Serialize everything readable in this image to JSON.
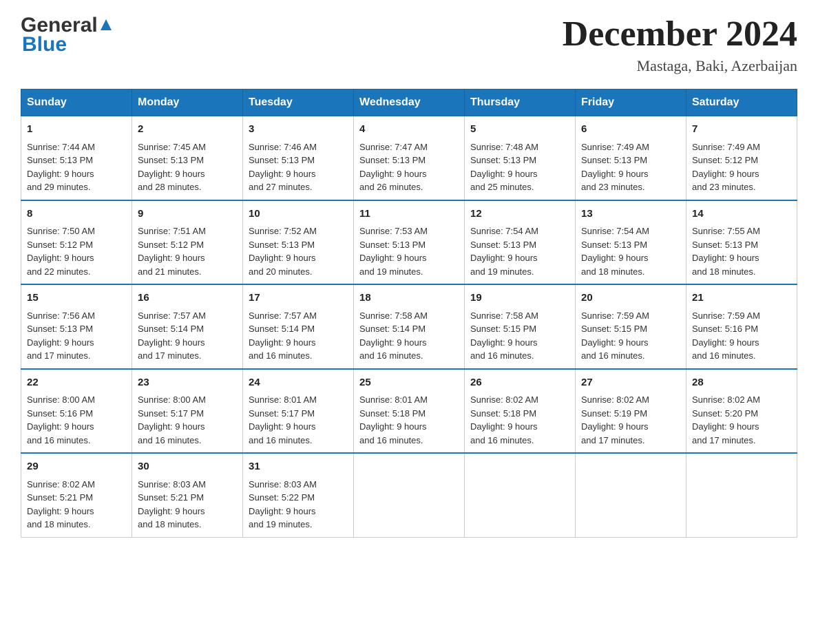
{
  "header": {
    "logo_general": "General",
    "logo_blue": "Blue",
    "month_year": "December 2024",
    "location": "Mastaga, Baki, Azerbaijan"
  },
  "days_header": [
    "Sunday",
    "Monday",
    "Tuesday",
    "Wednesday",
    "Thursday",
    "Friday",
    "Saturday"
  ],
  "weeks": [
    [
      {
        "day": "1",
        "sunrise": "7:44 AM",
        "sunset": "5:13 PM",
        "daylight": "9 hours and 29 minutes."
      },
      {
        "day": "2",
        "sunrise": "7:45 AM",
        "sunset": "5:13 PM",
        "daylight": "9 hours and 28 minutes."
      },
      {
        "day": "3",
        "sunrise": "7:46 AM",
        "sunset": "5:13 PM",
        "daylight": "9 hours and 27 minutes."
      },
      {
        "day": "4",
        "sunrise": "7:47 AM",
        "sunset": "5:13 PM",
        "daylight": "9 hours and 26 minutes."
      },
      {
        "day": "5",
        "sunrise": "7:48 AM",
        "sunset": "5:13 PM",
        "daylight": "9 hours and 25 minutes."
      },
      {
        "day": "6",
        "sunrise": "7:49 AM",
        "sunset": "5:13 PM",
        "daylight": "9 hours and 23 minutes."
      },
      {
        "day": "7",
        "sunrise": "7:49 AM",
        "sunset": "5:12 PM",
        "daylight": "9 hours and 23 minutes."
      }
    ],
    [
      {
        "day": "8",
        "sunrise": "7:50 AM",
        "sunset": "5:12 PM",
        "daylight": "9 hours and 22 minutes."
      },
      {
        "day": "9",
        "sunrise": "7:51 AM",
        "sunset": "5:12 PM",
        "daylight": "9 hours and 21 minutes."
      },
      {
        "day": "10",
        "sunrise": "7:52 AM",
        "sunset": "5:13 PM",
        "daylight": "9 hours and 20 minutes."
      },
      {
        "day": "11",
        "sunrise": "7:53 AM",
        "sunset": "5:13 PM",
        "daylight": "9 hours and 19 minutes."
      },
      {
        "day": "12",
        "sunrise": "7:54 AM",
        "sunset": "5:13 PM",
        "daylight": "9 hours and 19 minutes."
      },
      {
        "day": "13",
        "sunrise": "7:54 AM",
        "sunset": "5:13 PM",
        "daylight": "9 hours and 18 minutes."
      },
      {
        "day": "14",
        "sunrise": "7:55 AM",
        "sunset": "5:13 PM",
        "daylight": "9 hours and 18 minutes."
      }
    ],
    [
      {
        "day": "15",
        "sunrise": "7:56 AM",
        "sunset": "5:13 PM",
        "daylight": "9 hours and 17 minutes."
      },
      {
        "day": "16",
        "sunrise": "7:57 AM",
        "sunset": "5:14 PM",
        "daylight": "9 hours and 17 minutes."
      },
      {
        "day": "17",
        "sunrise": "7:57 AM",
        "sunset": "5:14 PM",
        "daylight": "9 hours and 16 minutes."
      },
      {
        "day": "18",
        "sunrise": "7:58 AM",
        "sunset": "5:14 PM",
        "daylight": "9 hours and 16 minutes."
      },
      {
        "day": "19",
        "sunrise": "7:58 AM",
        "sunset": "5:15 PM",
        "daylight": "9 hours and 16 minutes."
      },
      {
        "day": "20",
        "sunrise": "7:59 AM",
        "sunset": "5:15 PM",
        "daylight": "9 hours and 16 minutes."
      },
      {
        "day": "21",
        "sunrise": "7:59 AM",
        "sunset": "5:16 PM",
        "daylight": "9 hours and 16 minutes."
      }
    ],
    [
      {
        "day": "22",
        "sunrise": "8:00 AM",
        "sunset": "5:16 PM",
        "daylight": "9 hours and 16 minutes."
      },
      {
        "day": "23",
        "sunrise": "8:00 AM",
        "sunset": "5:17 PM",
        "daylight": "9 hours and 16 minutes."
      },
      {
        "day": "24",
        "sunrise": "8:01 AM",
        "sunset": "5:17 PM",
        "daylight": "9 hours and 16 minutes."
      },
      {
        "day": "25",
        "sunrise": "8:01 AM",
        "sunset": "5:18 PM",
        "daylight": "9 hours and 16 minutes."
      },
      {
        "day": "26",
        "sunrise": "8:02 AM",
        "sunset": "5:18 PM",
        "daylight": "9 hours and 16 minutes."
      },
      {
        "day": "27",
        "sunrise": "8:02 AM",
        "sunset": "5:19 PM",
        "daylight": "9 hours and 17 minutes."
      },
      {
        "day": "28",
        "sunrise": "8:02 AM",
        "sunset": "5:20 PM",
        "daylight": "9 hours and 17 minutes."
      }
    ],
    [
      {
        "day": "29",
        "sunrise": "8:02 AM",
        "sunset": "5:21 PM",
        "daylight": "9 hours and 18 minutes."
      },
      {
        "day": "30",
        "sunrise": "8:03 AM",
        "sunset": "5:21 PM",
        "daylight": "9 hours and 18 minutes."
      },
      {
        "day": "31",
        "sunrise": "8:03 AM",
        "sunset": "5:22 PM",
        "daylight": "9 hours and 19 minutes."
      },
      null,
      null,
      null,
      null
    ]
  ],
  "labels": {
    "sunrise": "Sunrise:",
    "sunset": "Sunset:",
    "daylight": "Daylight:"
  }
}
